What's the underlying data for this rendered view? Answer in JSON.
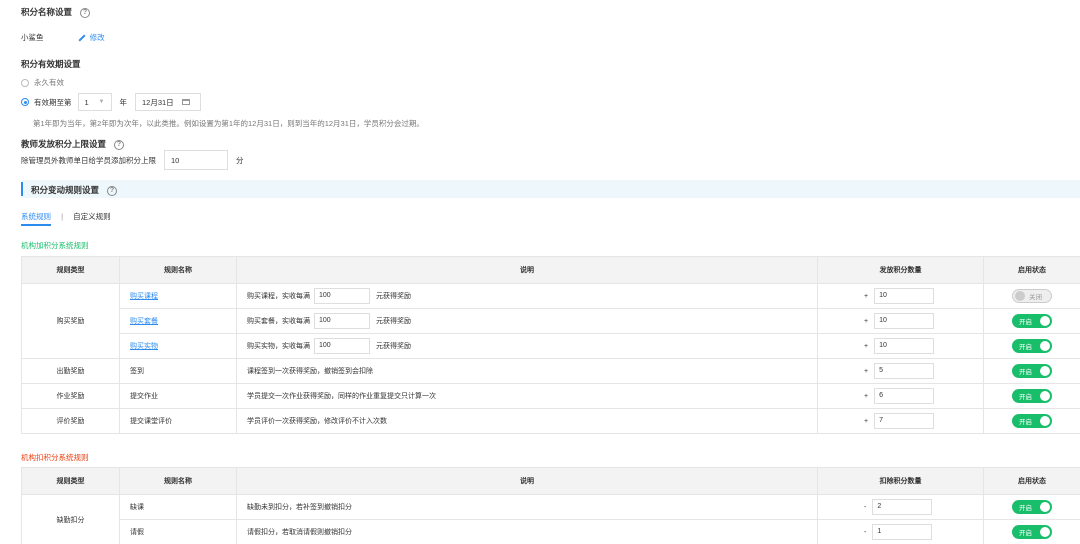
{
  "name_section": {
    "title": "积分名称设置",
    "help": "?",
    "value": "小鲨鱼",
    "edit": "修改"
  },
  "validity": {
    "title": "积分有效期设置",
    "option_forever": "永久有效",
    "option_until_prefix": "有效期至第",
    "year_value": "1",
    "year_unit": "年",
    "date_value": "12月31日",
    "note": "第1年即为当年，第2年即为次年，以此类推。例如设置为第1年的12月31日，则到当年的12月31日，学员积分会过期。"
  },
  "teacher_limit": {
    "title": "教师发放积分上限设置",
    "help": "?",
    "desc": "除管理员外教师单日给学员添加积分上限",
    "value": "10",
    "unit": "分"
  },
  "rules_section": {
    "title": "积分变动规则设置",
    "help": "?"
  },
  "tabs": [
    "系统规则",
    "自定义规则"
  ],
  "add_table": {
    "caption": "机构加积分系统规则",
    "headers": [
      "规则类型",
      "规则名称",
      "说明",
      "发放积分数量",
      "启用状态"
    ],
    "group_purchase": "购买奖励",
    "rows": [
      {
        "name": "购买课程",
        "desc_prefix": "购买课程，实收每满",
        "amount": "100",
        "desc_suffix": "元获得奖励",
        "sign": "+",
        "points": "10",
        "status": "关闭"
      },
      {
        "name": "购买套餐",
        "desc_prefix": "购买套餐，实收每满",
        "amount": "100",
        "desc_suffix": "元获得奖励",
        "sign": "+",
        "points": "10",
        "status": "开启"
      },
      {
        "name": "购买实物",
        "desc_prefix": "购买实物，实收每满",
        "amount": "100",
        "desc_suffix": "元获得奖励",
        "sign": "+",
        "points": "10",
        "status": "开启"
      },
      {
        "type": "出勤奖励",
        "name": "签到",
        "desc": "课程签到一次获得奖励，撤销签到会扣除",
        "sign": "+",
        "points": "5",
        "status": "开启"
      },
      {
        "type": "作业奖励",
        "name": "提交作业",
        "desc": "学员提交一次作业获得奖励，同样的作业重复提交只计算一次",
        "sign": "+",
        "points": "6",
        "status": "开启"
      },
      {
        "type": "评价奖励",
        "name": "提交课堂评价",
        "desc": "学员评价一次获得奖励，修改评价不计入次数",
        "sign": "+",
        "points": "7",
        "status": "开启"
      }
    ]
  },
  "deduct_table": {
    "caption": "机构扣积分系统规则",
    "headers": [
      "规则类型",
      "规则名称",
      "说明",
      "扣除积分数量",
      "启用状态"
    ],
    "group": "缺勤扣分",
    "rows": [
      {
        "name": "缺课",
        "desc": "缺勤未到扣分，若补签到撤销扣分",
        "sign": "-",
        "points": "2",
        "status": "开启"
      },
      {
        "name": "请假",
        "desc": "请假扣分，若取消请假则撤销扣分",
        "sign": "-",
        "points": "1",
        "status": "开启"
      }
    ]
  },
  "colors": {
    "accent": "#2d8cf0",
    "toggle_on": "#19be6b",
    "green_caption": "#19be6b",
    "red_caption": "#ed4014"
  }
}
